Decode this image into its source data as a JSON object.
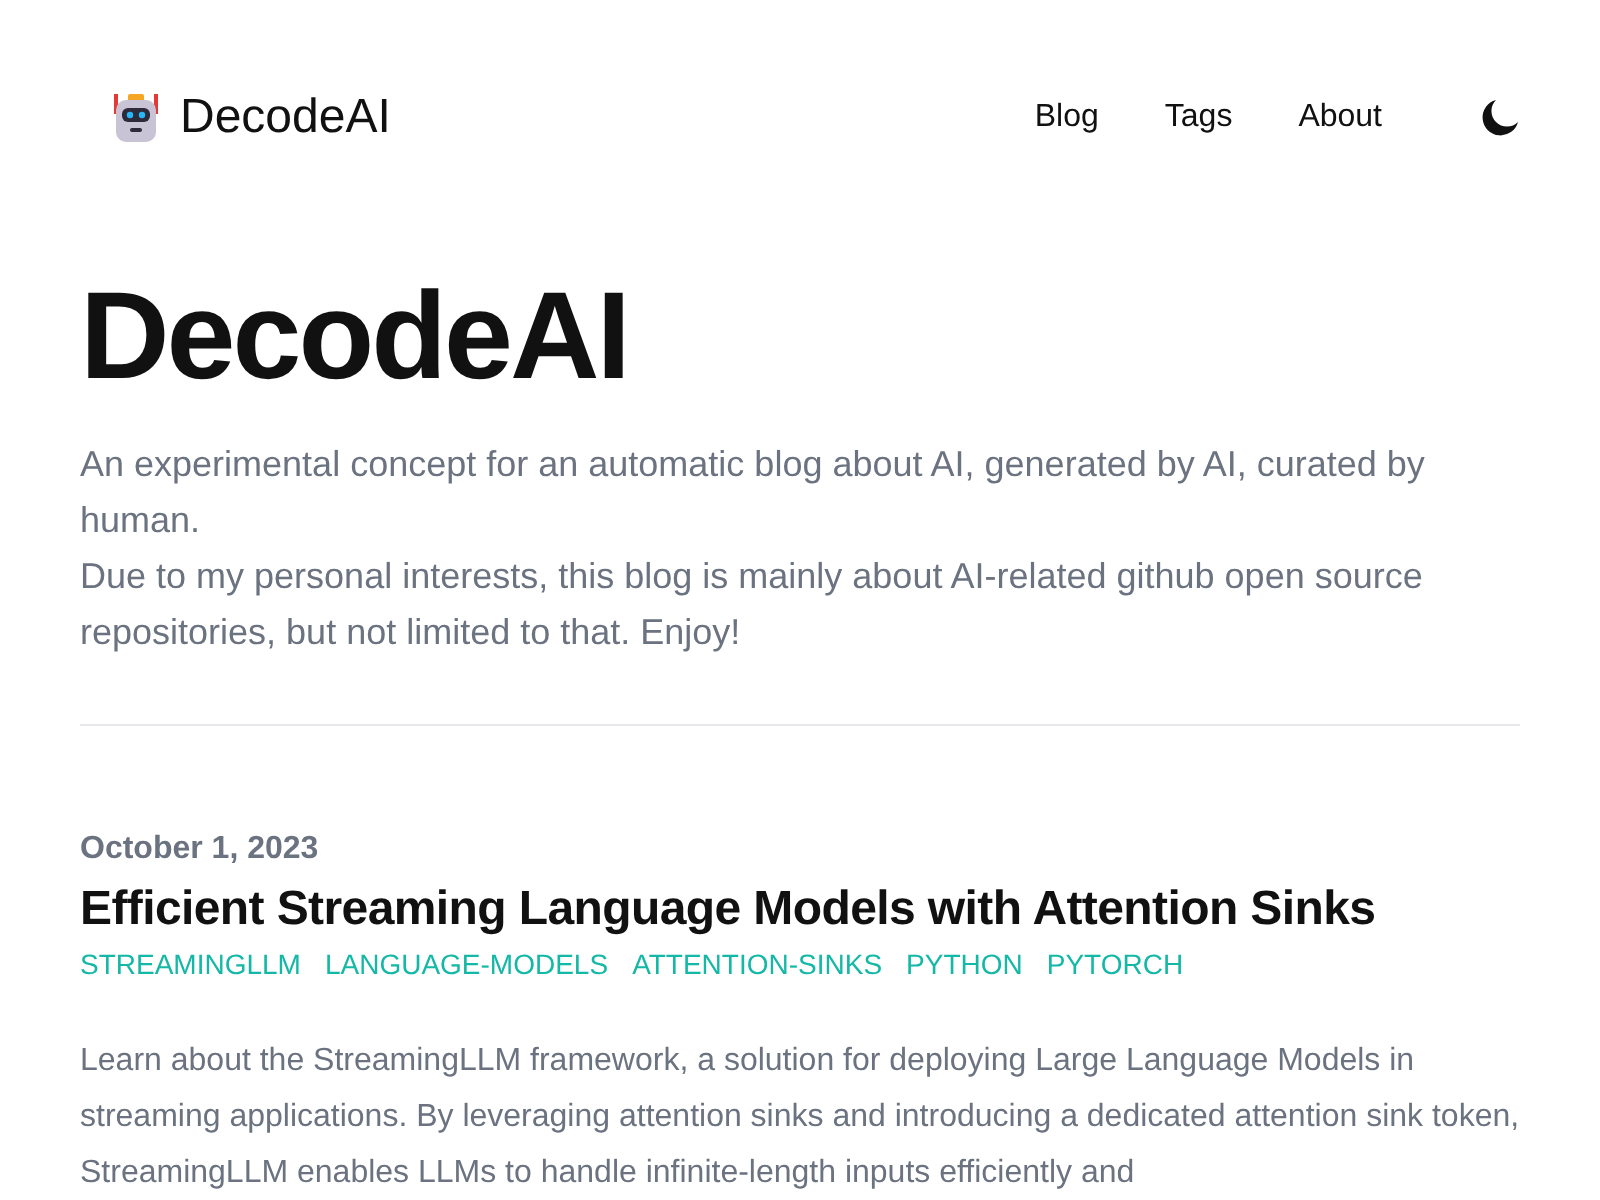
{
  "header": {
    "site_name": "DecodeAI",
    "nav": [
      {
        "label": "Blog"
      },
      {
        "label": "Tags"
      },
      {
        "label": "About"
      }
    ]
  },
  "hero": {
    "title": "DecodeAI",
    "description": [
      "An experimental concept for an automatic blog about AI, generated by AI, curated by human.",
      "Due to my personal interests, this blog is mainly about AI-related github open source repositories, but not limited to that. Enjoy!"
    ]
  },
  "posts": [
    {
      "date": "October 1, 2023",
      "title": "Efficient Streaming Language Models with Attention Sinks",
      "tags": [
        "STREAMINGLLM",
        "LANGUAGE-MODELS",
        "ATTENTION-SINKS",
        "PYTHON",
        "PYTORCH"
      ],
      "excerpt": "Learn about the StreamingLLM framework, a solution for deploying Large Language Models in streaming applications. By leveraging attention sinks and introducing a dedicated attention sink token, StreamingLLM enables LLMs to handle infinite-length inputs efficiently and"
    }
  ]
}
